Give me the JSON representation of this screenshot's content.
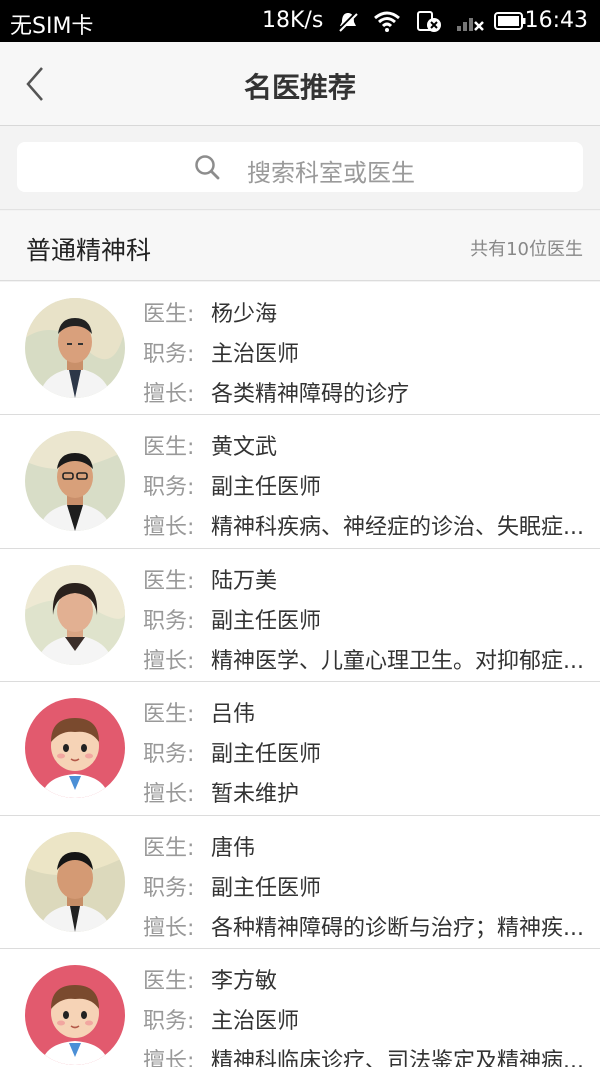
{
  "status_bar": {
    "carrier": "无SIM卡",
    "speed": "18K/s",
    "time": "16:43"
  },
  "header": {
    "title": "名医推荐",
    "back_icon": "chevron-left-icon"
  },
  "search": {
    "placeholder": "搜索科室或医生",
    "icon": "search-icon"
  },
  "section": {
    "department": "普通精神科",
    "count_text": "共有10位医生"
  },
  "labels": {
    "doctor": "医生:",
    "position": "职务:",
    "specialty": "擅长:"
  },
  "doctors": [
    {
      "name": "杨少海",
      "position": "主治医师",
      "specialty": "各类精神障碍的诊疗",
      "avatar": "photo-male-older"
    },
    {
      "name": "黄文武",
      "position": "副主任医师",
      "specialty": "精神科疾病、神经症的诊治、失眠症...",
      "avatar": "photo-male-glasses"
    },
    {
      "name": "陆万美",
      "position": "副主任医师",
      "specialty": "精神医学、儿童心理卫生。对抑郁症...",
      "avatar": "photo-female"
    },
    {
      "name": "吕伟",
      "position": "副主任医师",
      "specialty": "暂未维护",
      "avatar": "cartoon-doctor"
    },
    {
      "name": "唐伟",
      "position": "副主任医师",
      "specialty": "各种精神障碍的诊断与治疗；精神疾...",
      "avatar": "photo-male"
    },
    {
      "name": "李方敏",
      "position": "主治医师",
      "specialty": "精神科临床诊疗、司法鉴定及精神病...",
      "avatar": "cartoon-doctor"
    }
  ],
  "colors": {
    "cartoon_bg": "#e25a6e",
    "accent_text": "#333333",
    "label_text": "#999999"
  }
}
